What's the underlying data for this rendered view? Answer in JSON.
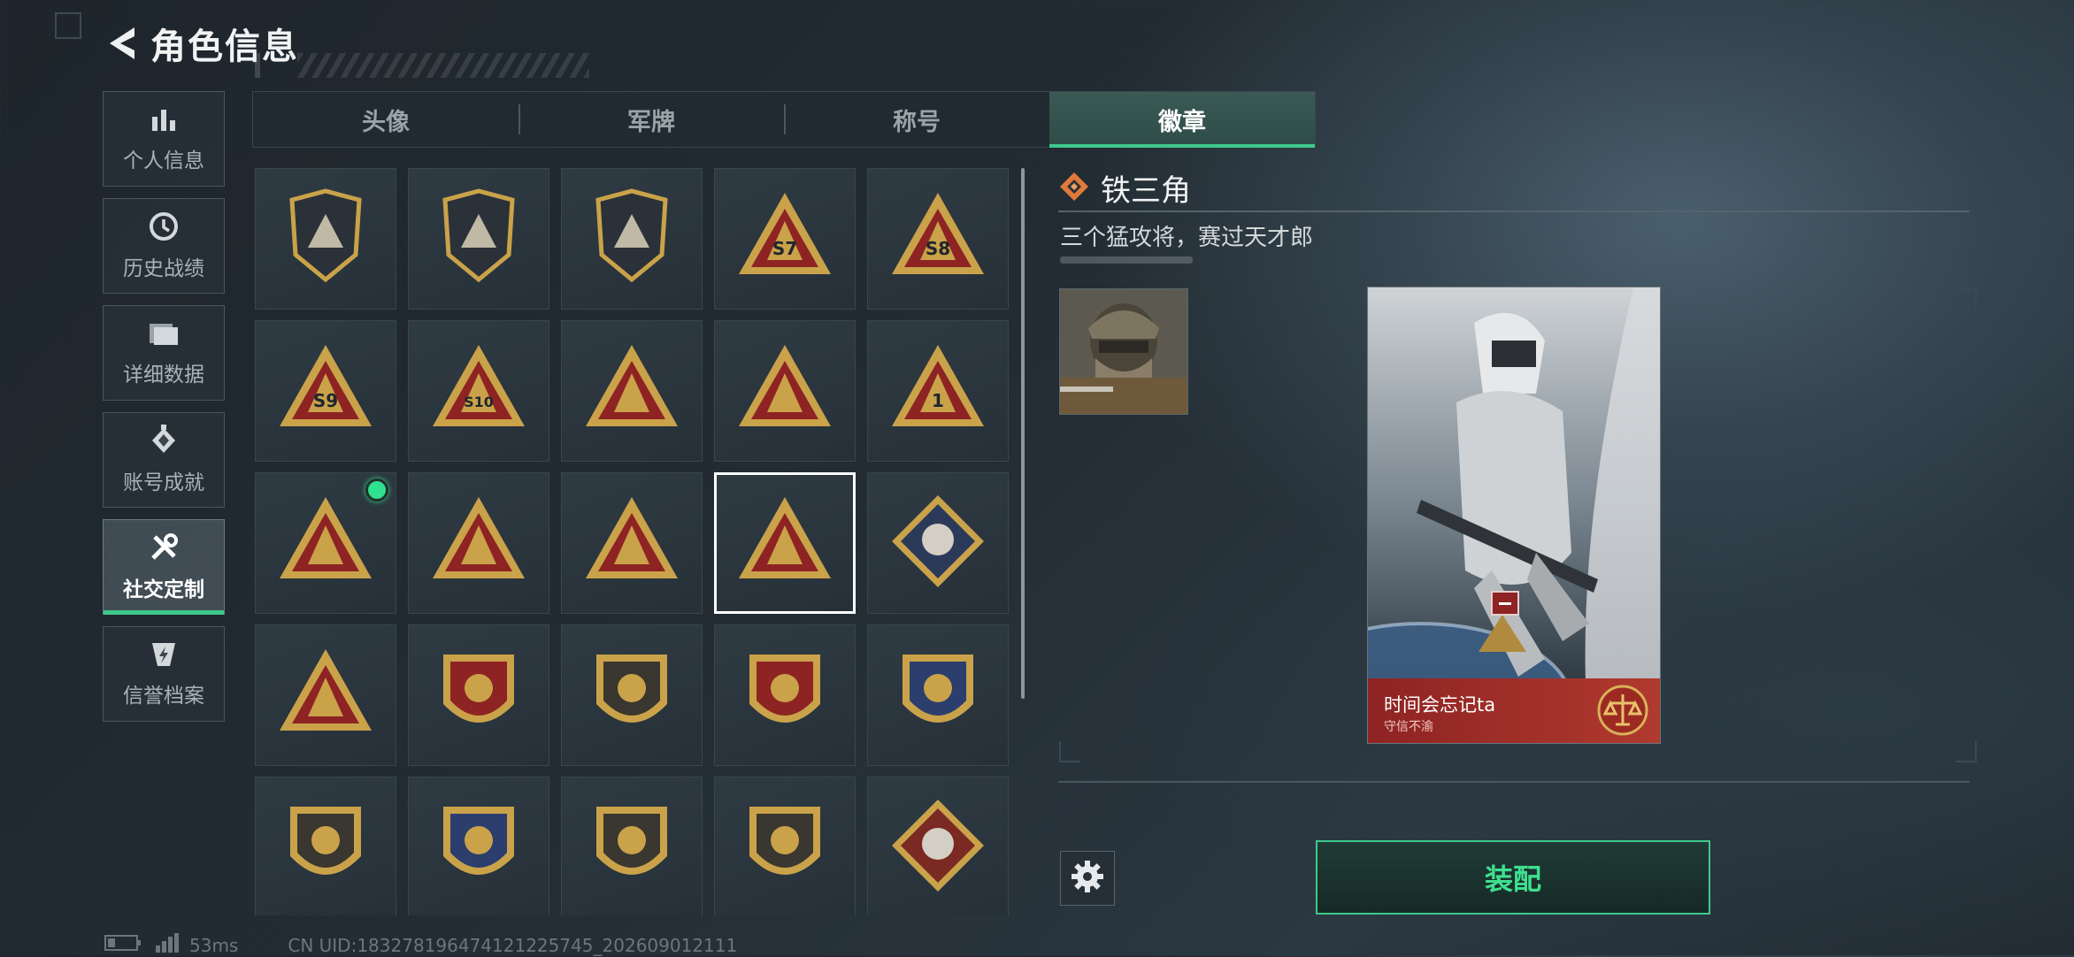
{
  "header": {
    "title": "角色信息",
    "back_icon": "back-arrow-icon"
  },
  "sidebar": {
    "items": [
      {
        "label": "个人信息",
        "icon": "bar-chart-icon"
      },
      {
        "label": "历史战绩",
        "icon": "history-clock-icon"
      },
      {
        "label": "详细数据",
        "icon": "folder-icon"
      },
      {
        "label": "账号成就",
        "icon": "achievement-medal-icon"
      },
      {
        "label": "社交定制",
        "icon": "tools-icon",
        "active": true
      },
      {
        "label": "信誉档案",
        "icon": "credit-shield-icon"
      }
    ]
  },
  "tabs": [
    {
      "label": "头像"
    },
    {
      "label": "军牌"
    },
    {
      "label": "称号"
    },
    {
      "label": "徽章",
      "active": true
    }
  ],
  "badges": {
    "selected_index": 13,
    "new_dot_index": 10,
    "items": [
      {
        "icon": "shield-triangle-badge-icon"
      },
      {
        "icon": "helicopter-badge-icon"
      },
      {
        "icon": "dagger-shield-badge-icon"
      },
      {
        "icon": "s7-season-badge-icon",
        "text": "S7"
      },
      {
        "icon": "s8-season-badge-icon",
        "text": "S8"
      },
      {
        "icon": "s9-season-badge-icon",
        "text": "S9"
      },
      {
        "icon": "s10-eagle-badge-icon",
        "text": "S10"
      },
      {
        "icon": "rock-hand-badge-icon"
      },
      {
        "icon": "bird-nest-badge-icon"
      },
      {
        "icon": "number-one-badge-icon",
        "text": "1"
      },
      {
        "icon": "usb-stick-badge-icon"
      },
      {
        "icon": "wave-soldier-badge-icon"
      },
      {
        "icon": "three-soldiers-badge-icon"
      },
      {
        "icon": "iron-triangle-badge-icon"
      },
      {
        "icon": "rose-diamond-badge-icon"
      },
      {
        "icon": "diver-badge-icon"
      },
      {
        "icon": "star-emblem-badge-icon"
      },
      {
        "icon": "chevron-shield-badge-icon"
      },
      {
        "icon": "winged-stars-badge-icon"
      },
      {
        "icon": "crystal-shield-badge-icon"
      },
      {
        "icon": "round-emblem-badge-icon"
      },
      {
        "icon": "rifle-crosshair-badge-icon"
      },
      {
        "icon": "rifle-shield-badge-icon"
      },
      {
        "icon": "gold-rifle-badge-icon"
      },
      {
        "icon": "wolf-diamond-badge-icon"
      }
    ]
  },
  "detail": {
    "name": "铁三角",
    "description": "三个猛攻将，赛过天才郎",
    "title_icon": "diamond-rank-icon",
    "card": {
      "name": "时间会忘记ta",
      "subtitle": "守信不渝",
      "emblem_icon": "scales-emblem-icon"
    }
  },
  "actions": {
    "equip_label": "装配",
    "settings_icon": "gear-icon"
  },
  "status": {
    "latency": "53ms",
    "uid": "CN UID:183278196474121225745_202609012111"
  },
  "colors": {
    "accent": "#3ec98c",
    "badge_gold": "#c9a24a",
    "badge_red": "#8e2323"
  }
}
